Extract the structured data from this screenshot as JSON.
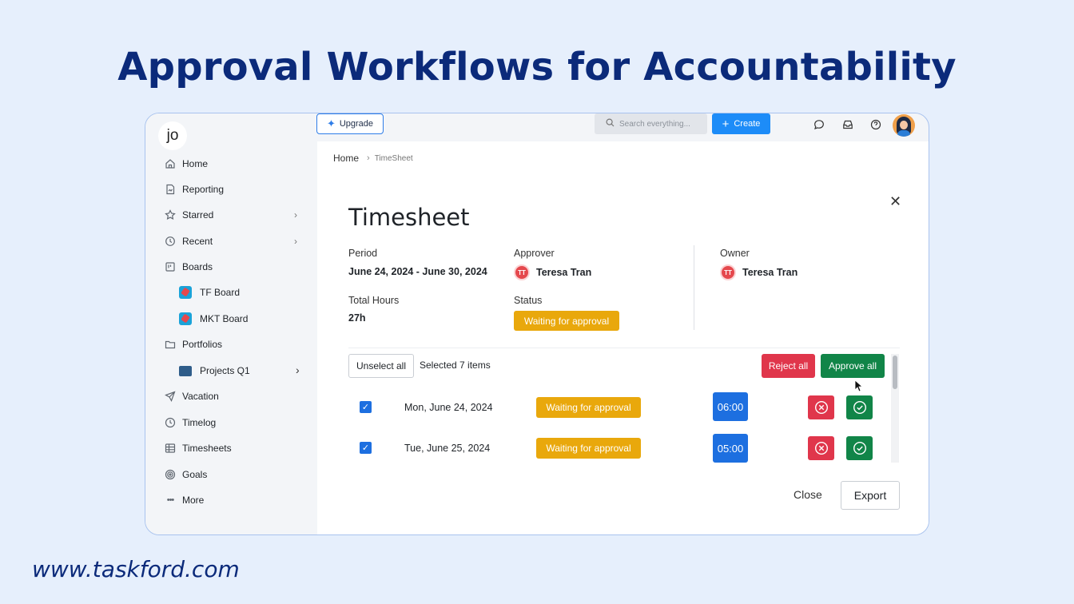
{
  "headline": "Approval Workflows for Accountability",
  "website": "www.taskford.com",
  "sidebar": {
    "logo": "jo",
    "items": [
      {
        "label": "Home",
        "icon": "home-icon"
      },
      {
        "label": "Reporting",
        "icon": "report-icon"
      },
      {
        "label": "Starred",
        "icon": "star-icon"
      },
      {
        "label": "Recent",
        "icon": "history-icon"
      },
      {
        "label": "Boards",
        "icon": "board-icon"
      },
      {
        "label": "TF Board",
        "icon": "tf-board-icon"
      },
      {
        "label": "MKT Board",
        "icon": "mkt-board-icon"
      },
      {
        "label": "Portfolios",
        "icon": "folder-icon"
      },
      {
        "label": "Projects Q1",
        "icon": "project-icon"
      },
      {
        "label": "Vacation",
        "icon": "plane-icon"
      },
      {
        "label": "Timelog",
        "icon": "clock-icon"
      },
      {
        "label": "Timesheets",
        "icon": "table-icon"
      },
      {
        "label": "Goals",
        "icon": "target-icon"
      },
      {
        "label": "More",
        "icon": "more-icon"
      }
    ]
  },
  "topbar": {
    "upgrade_label": "Upgrade",
    "search_placeholder": "Search everything...",
    "create_label": "Create"
  },
  "breadcrumb": {
    "home": "Home",
    "current": "TimeSheet"
  },
  "timesheet": {
    "title": "Timesheet",
    "period_label": "Period",
    "period_value": "June 24, 2024 - June 30, 2024",
    "approver_label": "Approver",
    "approver_initials": "TT",
    "approver_name": "Teresa Tran",
    "owner_label": "Owner",
    "owner_initials": "TT",
    "owner_name": "Teresa Tran",
    "total_hours_label": "Total Hours",
    "total_hours_value": "27h",
    "status_label": "Status",
    "status_value": "Waiting for approval",
    "unselect_label": "Unselect all",
    "selected_text": "Selected 7 items",
    "reject_all_label": "Reject all",
    "approve_all_label": "Approve all",
    "rows": [
      {
        "date": "Mon, June 24, 2024",
        "status": "Waiting for approval",
        "hours": "06:00"
      },
      {
        "date": "Tue, June 25, 2024",
        "status": "Waiting for approval",
        "hours": "05:00"
      }
    ],
    "close_label": "Close",
    "export_label": "Export"
  },
  "colors": {
    "headline": "#0b2a7a",
    "accent_blue": "#1d8cf8",
    "waiting": "#e9a80c",
    "reject": "#e0364b",
    "approve": "#118548"
  }
}
